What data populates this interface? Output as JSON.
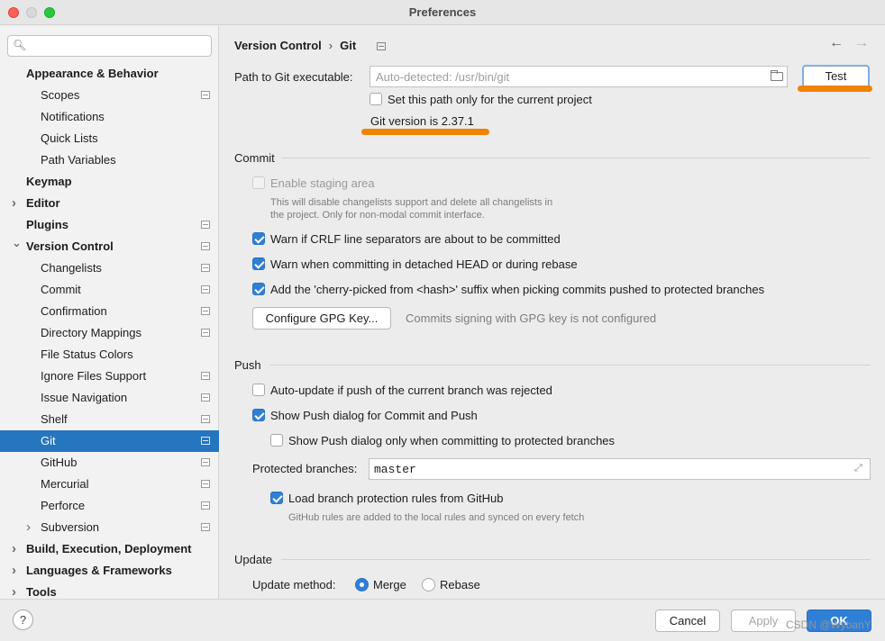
{
  "window": {
    "title": "Preferences"
  },
  "sidebar": {
    "search_placeholder": "",
    "items": [
      {
        "label": "Appearance & Behavior",
        "level": 0,
        "bold": true
      },
      {
        "label": "Scopes",
        "level": 1
      },
      {
        "label": "Notifications",
        "level": 1
      },
      {
        "label": "Quick Lists",
        "level": 1
      },
      {
        "label": "Path Variables",
        "level": 1
      },
      {
        "label": "Keymap",
        "level": 0,
        "bold": true
      },
      {
        "label": "Editor",
        "level": 0,
        "bold": true
      },
      {
        "label": "Plugins",
        "level": 0,
        "bold": true
      },
      {
        "label": "Version Control",
        "level": 0,
        "bold": true
      },
      {
        "label": "Changelists",
        "level": 1
      },
      {
        "label": "Commit",
        "level": 1
      },
      {
        "label": "Confirmation",
        "level": 1
      },
      {
        "label": "Directory Mappings",
        "level": 1
      },
      {
        "label": "File Status Colors",
        "level": 1
      },
      {
        "label": "Ignore Files Support",
        "level": 1
      },
      {
        "label": "Issue Navigation",
        "level": 1
      },
      {
        "label": "Shelf",
        "level": 1
      },
      {
        "label": "Git",
        "level": 1,
        "selected": true
      },
      {
        "label": "GitHub",
        "level": 1
      },
      {
        "label": "Mercurial",
        "level": 1
      },
      {
        "label": "Perforce",
        "level": 1
      },
      {
        "label": "Subversion",
        "level": 1
      },
      {
        "label": "Build, Execution, Deployment",
        "level": 0,
        "bold": true
      },
      {
        "label": "Languages & Frameworks",
        "level": 0,
        "bold": true
      },
      {
        "label": "Tools",
        "level": 0,
        "bold": true
      }
    ]
  },
  "breadcrumb": {
    "parent": "Version Control",
    "current": "Git"
  },
  "git": {
    "path_label": "Path to Git executable:",
    "path_placeholder": "Auto-detected: /usr/bin/git",
    "test_button": "Test",
    "project_only_label": "Set this path only for the current project",
    "version_text": "Git version is 2.37.1"
  },
  "commit": {
    "header": "Commit",
    "staging_label": "Enable staging area",
    "staging_hint_1": "This will disable changelists support and delete all changelists in",
    "staging_hint_2": "the project. Only for non-modal commit interface.",
    "crlf_label": "Warn if CRLF line separators are about to be committed",
    "detached_label": "Warn when committing in detached HEAD or during rebase",
    "cherry_label": "Add the 'cherry-picked from <hash>' suffix when picking commits pushed to protected branches",
    "gpg_button": "Configure GPG Key...",
    "gpg_status": "Commits signing with GPG key is not configured"
  },
  "push": {
    "header": "Push",
    "auto_update_label": "Auto-update if push of the current branch was rejected",
    "show_dialog_label": "Show Push dialog for Commit and Push",
    "show_dialog_protected_label": "Show Push dialog only when committing to protected branches",
    "protected_label": "Protected branches:",
    "protected_value": "master",
    "load_rules_label": "Load branch protection rules from GitHub",
    "load_rules_hint": "GitHub rules are added to the local rules and synced on every fetch"
  },
  "update": {
    "header": "Update",
    "method_label": "Update method:",
    "merge_label": "Merge",
    "rebase_label": "Rebase"
  },
  "footer": {
    "help": "?",
    "cancel": "Cancel",
    "apply": "Apply",
    "ok": "OK",
    "watermark": "CSDN @WybanY"
  },
  "colors": {
    "accent": "#2f7fd6",
    "selection": "#2675bf",
    "annotation": "#f08300"
  }
}
